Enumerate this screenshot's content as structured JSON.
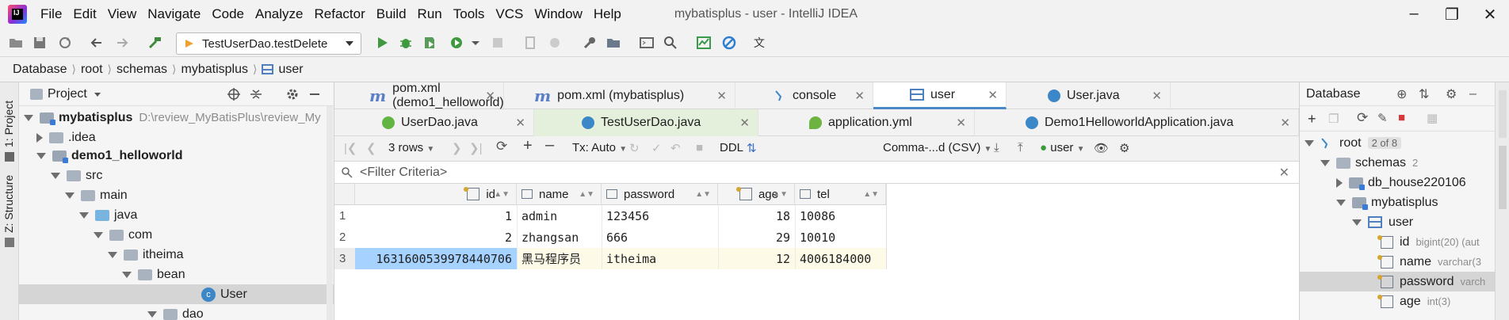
{
  "window": {
    "title": "mybatisplus - user - IntelliJ IDEA",
    "menu": [
      "File",
      "Edit",
      "View",
      "Navigate",
      "Code",
      "Analyze",
      "Refactor",
      "Build",
      "Run",
      "Tools",
      "VCS",
      "Window",
      "Help"
    ]
  },
  "toolbar": {
    "run_config": "TestUserDao.testDelete"
  },
  "breadcrumb": [
    "Database",
    "root",
    "schemas",
    "mybatisplus",
    "user"
  ],
  "left_stripe": {
    "project_tab": "1: Project",
    "structure_tab": "Z: Structure"
  },
  "project_panel": {
    "title": "Project",
    "tree": [
      {
        "label": "mybatisplus",
        "hint": "D:\\review_MyBatisPlus\\review_My",
        "bold": true
      },
      {
        "label": ".idea"
      },
      {
        "label": "demo1_helloworld",
        "bold": true
      },
      {
        "label": "src"
      },
      {
        "label": "main"
      },
      {
        "label": "java"
      },
      {
        "label": "com"
      },
      {
        "label": "itheima"
      },
      {
        "label": "bean"
      },
      {
        "label": "User"
      },
      {
        "label": "dao"
      }
    ]
  },
  "editor": {
    "tabs_row1": [
      {
        "label": "pom.xml (demo1_helloworld)"
      },
      {
        "label": "pom.xml (mybatisplus)"
      },
      {
        "label": "console"
      },
      {
        "label": "user"
      },
      {
        "label": "User.java"
      }
    ],
    "tabs_row2": [
      {
        "label": "UserDao.java"
      },
      {
        "label": "TestUserDao.java"
      },
      {
        "label": "application.yml"
      },
      {
        "label": "Demo1HelloworldApplication.java"
      }
    ],
    "db_toolbar": {
      "rows": "3 rows",
      "tx": "Tx: Auto",
      "ddl": "DDL",
      "export": "Comma-...d (CSV)",
      "user": "user"
    },
    "filter_placeholder": "<Filter Criteria>",
    "grid": {
      "columns": [
        "id",
        "name",
        "password",
        "age",
        "tel"
      ],
      "rows": [
        {
          "num": "1",
          "id": "1",
          "name": "admin",
          "password": "123456",
          "age": "18",
          "tel": "10086"
        },
        {
          "num": "2",
          "id": "2",
          "name": "zhangsan",
          "password": "666",
          "age": "29",
          "tel": "10010"
        },
        {
          "num": "3",
          "id": "1631600539978440706",
          "name": "黑马程序员",
          "password": "itheima",
          "age": "12",
          "tel": "4006184000"
        }
      ]
    }
  },
  "db_panel": {
    "title": "Database",
    "tree": [
      {
        "label": "root",
        "badge": "2 of 8"
      },
      {
        "label": "schemas",
        "hint": "2"
      },
      {
        "label": "db_house220106"
      },
      {
        "label": "mybatisplus"
      },
      {
        "label": "user"
      },
      {
        "label": "id",
        "hint": "bigint(20) (aut"
      },
      {
        "label": "name",
        "hint": "varchar(3"
      },
      {
        "label": "password",
        "hint": "varch"
      },
      {
        "label": "age",
        "hint": "int(3)"
      }
    ]
  },
  "colors": {
    "accent": "#4a88c7",
    "selected_cell": "#a6d2ff",
    "row_highlight": "#fdfbe8"
  }
}
